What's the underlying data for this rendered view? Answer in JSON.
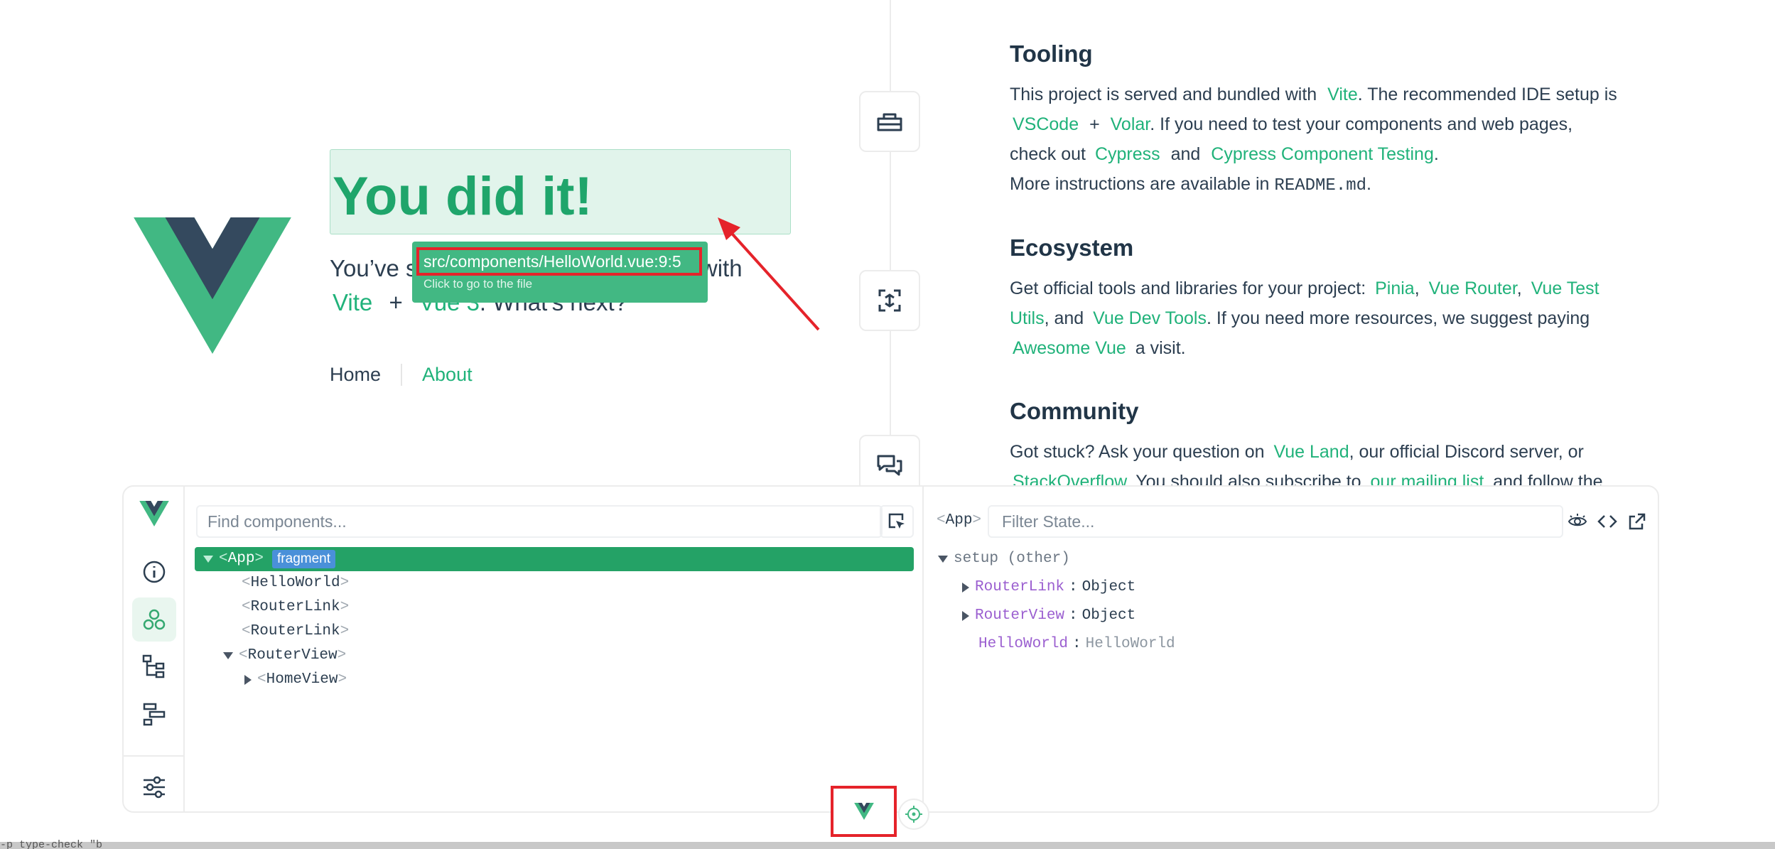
{
  "hero": {
    "title": "You did it!",
    "subtitle_start": "You’ve s",
    "subtitle_end": "t with",
    "link_vite": "Vite",
    "plus": "+",
    "link_vue3": "Vue 3",
    "whats_next": ". What's next?"
  },
  "nav": {
    "home": "Home",
    "about": "About"
  },
  "tooltip": {
    "path": "src/components/HelloWorld.vue:9:5",
    "hint": "Click to go to the file"
  },
  "tooling": {
    "heading": "Tooling",
    "l1a": "This project is served and bundled with",
    "l1_link": "Vite",
    "l1b": ". The recommended IDE setup is",
    "l2_link1": "VSCode",
    "l2_plus": "+",
    "l2_link2": "Volar",
    "l2b": ". If you need to test your components and web pages,",
    "l3a": "check out",
    "l3_link1": "Cypress",
    "l3_and": "and",
    "l3_link2": "Cypress Component Testing",
    "l3_end": ".",
    "l4a": "More instructions are available in",
    "l4_code": "README.md",
    "l4_end": "."
  },
  "ecosystem": {
    "heading": "Ecosystem",
    "l1a": "Get official tools and libraries for your project:",
    "pinia": "Pinia",
    "comma": ",",
    "router": "Vue Router",
    "vtu1": "Vue Test",
    "vtu2": "Utils",
    "and": ", and",
    "devtools": "Vue Dev Tools",
    "l2b": ". If you need more resources, we suggest paying",
    "awesome": "Awesome Vue",
    "visit": "a visit."
  },
  "community": {
    "heading": "Community",
    "l1a": "Got stuck? Ask your question on",
    "vueland": "Vue Land",
    "l1b": ", our official Discord server, or",
    "so": "StackOverflow",
    "l2b": ". You should also subscribe to",
    "mailing": "our mailing list",
    "l2c": "and follow the"
  },
  "devtools": {
    "search_placeholder": "Find components...",
    "filter_placeholder": "Filter State...",
    "crumb": "App",
    "tree": {
      "app": "App",
      "badge": "fragment",
      "hello": "HelloWorld",
      "link1": "RouterLink",
      "link2": "RouterLink",
      "view": "RouterView",
      "home": "HomeView"
    },
    "state": {
      "section": "setup (other)",
      "rows": [
        {
          "key": "RouterLink",
          "sep": ":",
          "value": "Object"
        },
        {
          "key": "RouterView",
          "sep": ":",
          "value": "Object"
        },
        {
          "key": "HelloWorld",
          "sep": ":",
          "value": "HelloWorld"
        }
      ]
    }
  },
  "terminal": {
    "text": "-p type-check \"b"
  },
  "colors": {
    "vue_green": "#42b883",
    "vue_dark": "#35495e",
    "highlight_red": "#e5232a",
    "selected_row": "#24a266"
  },
  "icons": [
    "toolbox-icon",
    "focus-icon",
    "chat-icon",
    "info-icon",
    "components-icon",
    "tree-icon",
    "timeline-icon",
    "settings-icon",
    "picker-icon",
    "eye-icon",
    "code-icon",
    "external-link-icon",
    "target-icon"
  ]
}
